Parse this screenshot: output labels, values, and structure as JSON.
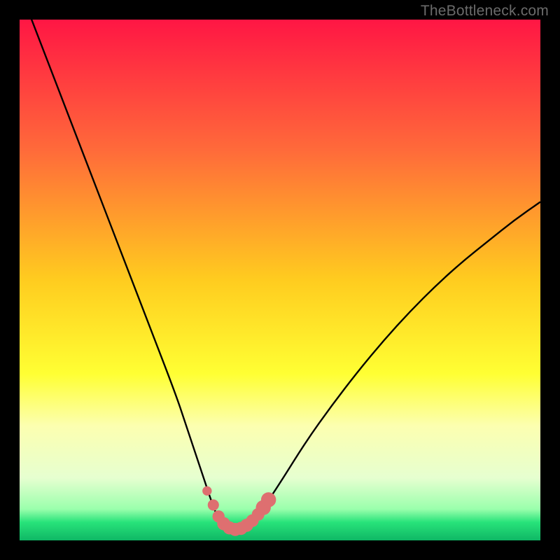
{
  "watermark": "TheBottleneck.com",
  "colors": {
    "frame_bg": "#000000",
    "curve": "#000000",
    "marker": "#de6f70",
    "gradient_stops": [
      {
        "offset": 0.0,
        "color": "#ff1644"
      },
      {
        "offset": 0.25,
        "color": "#ff6a3a"
      },
      {
        "offset": 0.5,
        "color": "#ffcc1f"
      },
      {
        "offset": 0.68,
        "color": "#ffff33"
      },
      {
        "offset": 0.78,
        "color": "#fcffb0"
      },
      {
        "offset": 0.88,
        "color": "#e6ffd0"
      },
      {
        "offset": 0.94,
        "color": "#9affac"
      },
      {
        "offset": 0.965,
        "color": "#28e37a"
      },
      {
        "offset": 1.0,
        "color": "#0fb765"
      }
    ]
  },
  "chart_data": {
    "type": "line",
    "title": "",
    "xlabel": "",
    "ylabel": "",
    "xlim": [
      0,
      100
    ],
    "ylim": [
      0,
      100
    ],
    "grid": false,
    "legend": false,
    "series": [
      {
        "name": "bottleneck-curve",
        "x": [
          0,
          5,
          10,
          15,
          20,
          25,
          30,
          32,
          34,
          36,
          37,
          38,
          39,
          40,
          41,
          42,
          43,
          44,
          46,
          50,
          55,
          60,
          65,
          70,
          75,
          80,
          85,
          90,
          95,
          100
        ],
        "y": [
          106,
          93,
          80,
          67,
          54,
          41,
          28,
          22,
          16,
          10,
          7,
          4.5,
          3,
          2.3,
          2,
          2,
          2.3,
          3,
          5,
          11,
          19,
          26,
          32.5,
          38.5,
          44,
          49,
          53.5,
          57.5,
          61.5,
          65
        ]
      }
    ],
    "markers": {
      "name": "optimal-range",
      "color": "#de6f70",
      "points": [
        {
          "x": 36.0,
          "y": 9.5,
          "r": 1.0
        },
        {
          "x": 37.2,
          "y": 6.8,
          "r": 1.2
        },
        {
          "x": 38.2,
          "y": 4.6,
          "r": 1.3
        },
        {
          "x": 39.2,
          "y": 3.2,
          "r": 1.4
        },
        {
          "x": 40.3,
          "y": 2.4,
          "r": 1.4
        },
        {
          "x": 41.4,
          "y": 2.1,
          "r": 1.4
        },
        {
          "x": 42.5,
          "y": 2.3,
          "r": 1.4
        },
        {
          "x": 43.6,
          "y": 2.9,
          "r": 1.4
        },
        {
          "x": 44.7,
          "y": 3.8,
          "r": 1.35
        },
        {
          "x": 45.8,
          "y": 5.0,
          "r": 1.35
        },
        {
          "x": 46.8,
          "y": 6.3,
          "r": 1.6
        },
        {
          "x": 47.8,
          "y": 7.8,
          "r": 1.6
        }
      ]
    }
  }
}
